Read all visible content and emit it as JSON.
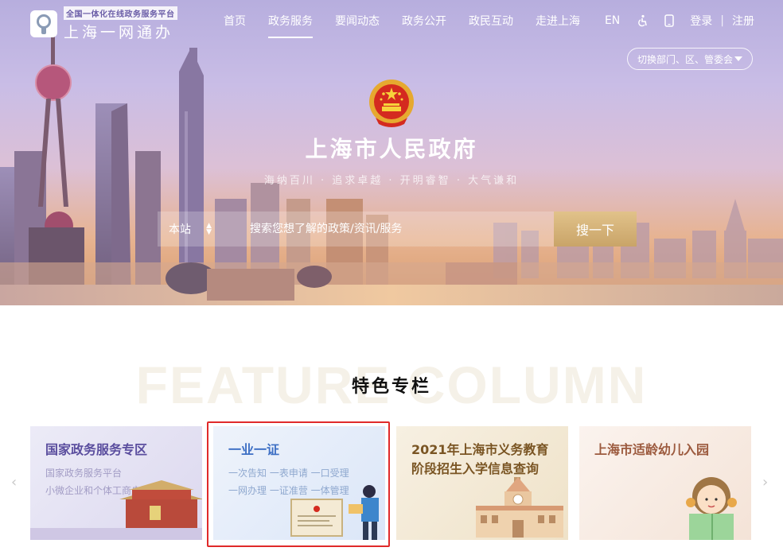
{
  "header": {
    "logo_sub": "全国一体化在线政务服务平台",
    "logo_main": "上海一网通办",
    "nav": [
      "首页",
      "政务服务",
      "要闻动态",
      "政务公开",
      "政民互动",
      "走进上海"
    ],
    "lang": "EN",
    "login": "登录",
    "sep": "|",
    "register": "注册",
    "dept_select": "切换部门、区、管委会"
  },
  "hero": {
    "title": "上海市人民政府",
    "slogan": "海纳百川 · 追求卓越 · 开明睿智 · 大气谦和",
    "search_scope": "本站",
    "search_placeholder": "搜索您想了解的政策/资讯/服务",
    "search_button": "搜一下"
  },
  "feature": {
    "bg_text": "FEATURE COLUMN",
    "title": "特色专栏",
    "prev_arrow": "‹",
    "next_arrow": "›",
    "cards": [
      {
        "title": "国家政务服务专区",
        "sub1": "国家政务服务平台",
        "sub2": "小微企业和个体工商户服务"
      },
      {
        "title": "一业一证",
        "sub1": "一次告知 一表申请 一口受理",
        "sub2": "一网办理 一证准营 一体管理"
      },
      {
        "title_l1": "2021年上海市义务教育",
        "title_l2": "阶段招生入学信息查询"
      },
      {
        "title": "上海市适龄幼儿入园"
      }
    ]
  },
  "colors": {
    "accent_gold": "#c9a468",
    "highlight_border": "#e02a2a"
  }
}
